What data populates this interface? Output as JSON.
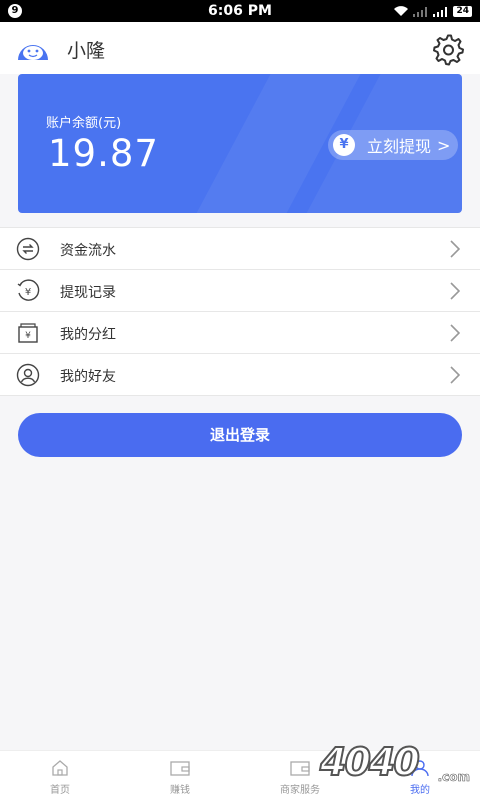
{
  "status_bar": {
    "badge": "9",
    "time": "6:06 PM",
    "battery": "24"
  },
  "header": {
    "username": "小隆"
  },
  "balance": {
    "label": "账户余额(元)",
    "amount": "19.87",
    "withdraw_label": "立刻提现",
    "yen_symbol": "¥"
  },
  "menu": {
    "items": [
      {
        "label": "资金流水",
        "icon": "exchange-icon"
      },
      {
        "label": "提现记录",
        "icon": "yen-record-icon"
      },
      {
        "label": "我的分红",
        "icon": "wallet-icon"
      },
      {
        "label": "我的好友",
        "icon": "friend-icon"
      }
    ]
  },
  "logout_label": "退出登录",
  "tabbar": {
    "tabs": [
      {
        "label": "首页",
        "icon": "home-icon"
      },
      {
        "label": "赚钱",
        "icon": "wallet-icon"
      },
      {
        "label": "商家服务",
        "icon": "wallet-icon"
      },
      {
        "label": "我的",
        "icon": "user-icon"
      }
    ],
    "active_index": 3
  },
  "watermark": {
    "text": "4040",
    "suffix": ".com"
  },
  "colors": {
    "accent": "#4a6cf0",
    "card": "#4a74f0",
    "background": "#f6f6f8"
  }
}
